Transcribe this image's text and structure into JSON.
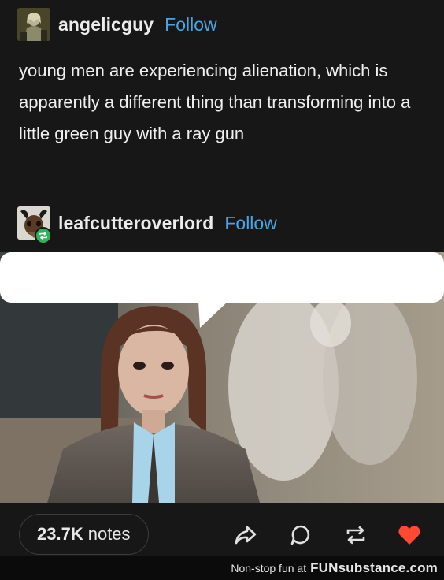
{
  "post": {
    "original_user": {
      "username": "angelicguy",
      "follow_label": "Follow"
    },
    "body": "young men are experiencing alienation, which is apparently a different thing than transforming into a little green guy with a ray gun",
    "reblog_user": {
      "username": "leafcutteroverlord",
      "follow_label": "Follow"
    },
    "speech_bubble_text": ""
  },
  "footer": {
    "notes_count": "23.7K",
    "notes_label": "notes",
    "actions": [
      "share-icon",
      "reply-icon",
      "reblog-icon",
      "like-icon"
    ],
    "like_color": "#ff4930"
  },
  "watermark": {
    "text": "Non-stop fun at",
    "brand": "FUNsubstance.com"
  },
  "colors": {
    "follow": "#4aa3e3",
    "background": "#171717",
    "reblog_badge": "#2fb35a"
  }
}
